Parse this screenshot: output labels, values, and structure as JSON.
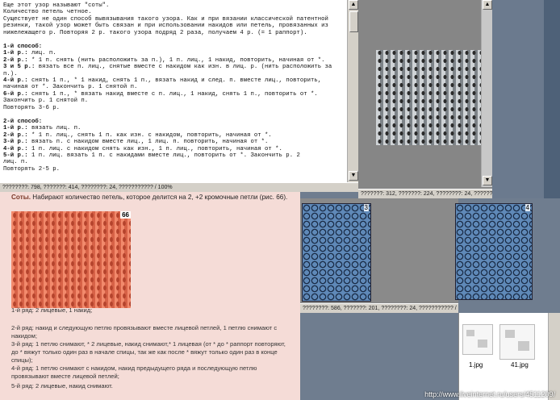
{
  "text_window": {
    "lines": [
      "Еще этот узор называют \"соты\".",
      "Количество петель четное.",
      "Существует не один способ вывязывания такого узора. Как и при вязании классической патентной",
      "резинки, такой узор может быть связан и при использовании накидов или петель, провязанных из",
      "нижележащего р. Повторяя 2 р. такого узора подряд 2 раза, получаем 4 р. (= 1 раппорт).",
      "",
      "1-й способ:",
      "1-й р.: лиц. п.",
      "2-й р.: * 1 п. снять (нить расположить за п.), 1 п. лиц., 1 накид, повторить, начиная от *.",
      "3 и 5 р.: вязать все п. лиц., снятые вместе с накидом как изн. в лиц. р. (нить расположить за",
      "п.).",
      "4-й р.: снять 1 п., * 1 накид, снять 1 п., вязать накид и след. п. вместе лиц., повторить,",
      "начиная от *. Закончить р. 1 снятой п.",
      "6-й р.: снять 1 п., * вязать накид вместе с п. лиц., 1 накид, снять 1 п., повторить от *.",
      "Закончить р. 1 снятой п.",
      "Повторять 3-6 р.",
      "",
      "2-й способ:",
      "1-й р.: вязать лиц. п.",
      "2-й р.: * 1 п. лиц., снять 1 п. как изн. с накидом, повторить, начиная от *.",
      "3-й р.: вязать п. с накидом вместе лиц., 1 лиц. п. повторить, начиная от *.",
      "4-й р.: 1 п. лиц. с накидом снять как изн., 1 п. лиц., повторить, начиная от *.",
      "5-й р.: 1 п. лиц. вязать 1 п. с накидами вместе лиц., повторить от *. Закончить р. 2",
      "лиц. п.",
      "Повторять 2-5 р."
    ],
    "status": "????????: 798, ???????: 414, ????????: 24, ??????????? / 100%"
  },
  "image_window_1": {
    "status": "???????: 312, ???????: 224, ????????: 24, ??????????? / 100%"
  },
  "pink_page": {
    "heading_bold": "Соты.",
    "heading_rest": " Набирают количество петель, которое делится на 2, +2 кромочные петли (рис. 66).",
    "figure_number": "66",
    "rows": [
      "1-й ряд: 2 лицевые, 1 накид;",
      "2-й ряд: накид и следующую петлю провязывают вместе лицевой петлей, 1 петлю снимают с накидом;",
      "3-й ряд: 1 петлю снимают, * 2 лицевые, накид снимают,* 1 лицевая (от * до * раппорт повторяют, до * вяжут только один раз в начале спицы, так же как после * вяжут только один раз в конце спицы);",
      "4-й ряд: 1 петлю снимают с накидом, накид предыдущего ряда и последующую петлю провязывают вместе лицевой петлей;",
      "5-й ряд: 2 лицевые, накид снимают."
    ]
  },
  "diagram_window": {
    "diagrams": [
      {
        "number": "3"
      },
      {
        "number": "4"
      }
    ],
    "status": "????????: 586, ???????: 201, ????????: 24, ??????????? / 100%"
  },
  "folder_window": {
    "files": [
      {
        "name": "1.jpg"
      },
      {
        "name": "41.jpg"
      }
    ]
  },
  "url_overlay": "http://www.liveinternet.ru/users/4511209/",
  "colors": {
    "desktop": "#6f7d8f",
    "pink_bg": "#f5dcd7",
    "knit_orange": "#e8765a",
    "diagram_blue": "#5f89b8"
  }
}
